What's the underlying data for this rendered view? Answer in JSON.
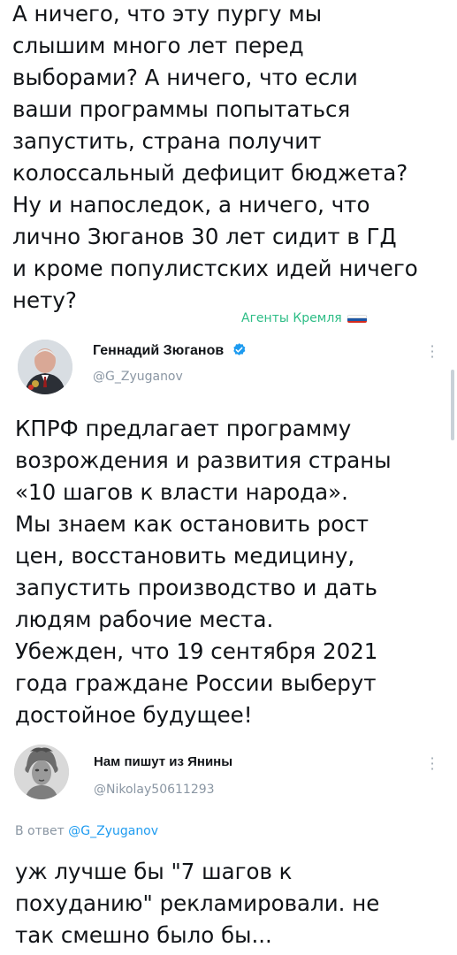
{
  "top_comment": {
    "text": "А ничего, что эту пургу мы\nслышим много лет перед\nвыборами? А ничего, что если\nваши программы попытаться\nзапустить, страна получит\nколоссальный дефицит бюджета?\nНу и напоследок, а ничего, что\nлично Зюганов 30 лет сидит в ГД\nи кроме популистских идей ничего\nнету?"
  },
  "watermark": {
    "text": "Агенты Кремля",
    "color": "#2dbd86",
    "flag_icon": "russia-flag-icon"
  },
  "tweet1": {
    "author_name": "Геннадий Зюганов",
    "handle": "@G_Zyuganov",
    "verified": true,
    "more_icon": "more-vertical-icon",
    "text": "КПРФ предлагает программу\nвозрождения и развития страны\n«10 шагов к власти народа».\nМы знаем как остановить рост\nцен, восстановить медицину,\nзапустить производство и дать\nлюдям рабочие места.\nУбежден, что 19 сентября 2021\nгода граждане России выберут\nдостойное будущее!"
  },
  "tweet2": {
    "author_name": "Нам пишут из Янины",
    "handle": "@Nikolay50611293",
    "more_icon": "more-vertical-icon",
    "reply_prefix": "В ответ",
    "reply_to": "@G_Zyuganov",
    "text": "уж лучше бы \"7 шагов к\nпохуданию\" рекламировали. не\nтак смешно было бы..."
  },
  "colors": {
    "link": "#1d9bf0",
    "secondary_text": "#8a96a3",
    "primary_text": "#111418"
  }
}
